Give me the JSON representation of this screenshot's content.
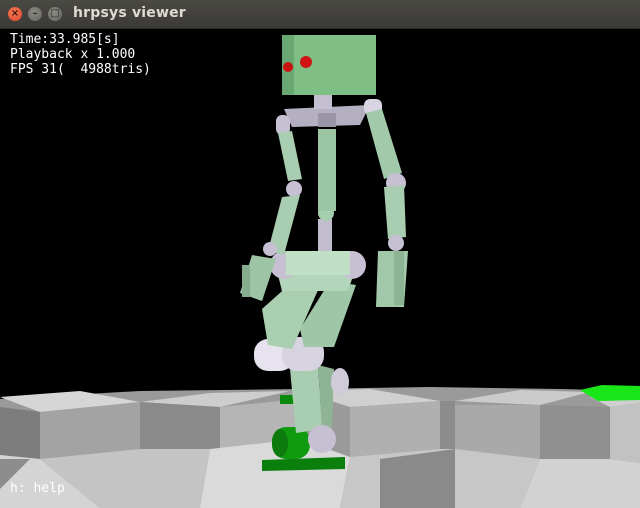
{
  "window": {
    "title": "hrpsys viewer",
    "close_glyph": "×",
    "minimize_glyph": "–",
    "maximize_glyph": "□"
  },
  "hud": {
    "time": "Time:33.985[s]",
    "playback": "Playback x 1.000",
    "fps": "FPS 31(  4988tris)",
    "help": "h: help"
  },
  "colors": {
    "background": "#000000",
    "robot_body": "#a9cfb0",
    "robot_head": "#7fbf86",
    "robot_joint": "#c6c0d2",
    "robot_eye": "#cc1111",
    "feet": "#0a8a0a",
    "floor_light": "#cfcfcf",
    "floor_dark": "#8f8f8f",
    "marker": "#19e619"
  },
  "icons": [
    "close-icon",
    "minimize-icon",
    "maximize-icon"
  ]
}
